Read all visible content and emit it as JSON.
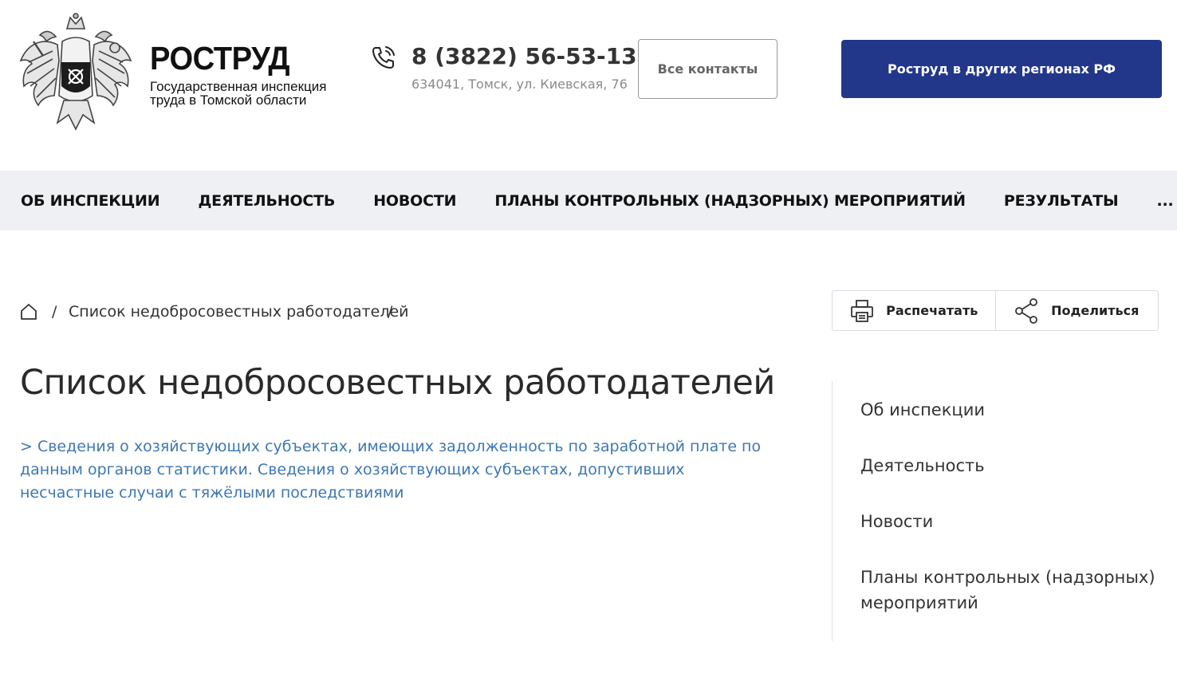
{
  "header": {
    "brand_title": "РОСТРУД",
    "brand_subtitle": "Государственная инспекция труда в Томской области",
    "phone": "8 (3822) 56-53-13",
    "address": "634041, Томск, ул. Киевская, 76",
    "contacts_button": "Все контакты",
    "regions_button": "Роструд в других регионах РФ"
  },
  "nav": {
    "items": [
      "ОБ ИНСПЕКЦИИ",
      "ДЕЯТЕЛЬНОСТЬ",
      "НОВОСТИ",
      "ПЛАНЫ КОНТРОЛЬНЫХ (НАДЗОРНЫХ) МЕРОПРИЯТИЙ",
      "РЕЗУЛЬТАТЫ",
      "..."
    ]
  },
  "breadcrumb": {
    "separator": "/",
    "current": "Список недобросовестных работодателей"
  },
  "tools": {
    "print_label": "Распечатать",
    "share_label": "Поделиться"
  },
  "main": {
    "title": "Список недобросовестных работодателей",
    "link_text": "> Сведения о хозяйствующих субъектах, имеющих задолженность по заработной плате по данным органов статистики. Сведения о хозяйствующих субъектах, допустивших несчастные случаи с тяжёлыми последствиями"
  },
  "side_menu": {
    "items": [
      "Об инспекции",
      "Деятельность",
      "Новости",
      "Планы контрольных (надзорных) мероприятий"
    ]
  },
  "colors": {
    "primary_button": "#22368a",
    "link": "#3d78b3",
    "nav_background": "#eef0f4"
  },
  "icons": {
    "emblem": "double-headed-eagle-emblem",
    "phone": "phone-icon",
    "home": "home-icon",
    "print": "printer-icon",
    "share": "share-icon"
  }
}
